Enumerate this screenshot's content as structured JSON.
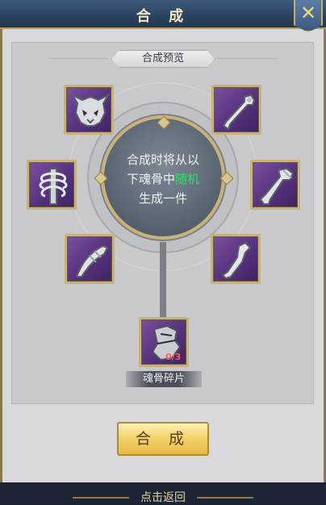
{
  "title": "合 成",
  "close_icon": "close-icon",
  "preview_label": "合成预览",
  "center": {
    "line1": "合成时将从以",
    "line2_pre": "下魂骨中",
    "line2_highlight": "随机",
    "line3": "生成一件"
  },
  "fragment": {
    "count": "0/3",
    "label": "魂骨碎片"
  },
  "craft_button": "合 成",
  "back_text": "点击返回",
  "colors": {
    "title_bar": "#2b4260",
    "highlight": "#32e06b",
    "slot_purple": "#53307a",
    "button_gold": "#f2d36b",
    "count_red": "#ff5a5a"
  },
  "slots": [
    {
      "icon": "skull-helmet-icon"
    },
    {
      "icon": "arm-bone-icon"
    },
    {
      "icon": "rib-cage-icon"
    },
    {
      "icon": "leg-bone-icon"
    },
    {
      "icon": "claw-bone-icon"
    },
    {
      "icon": "bent-bone-icon"
    },
    {
      "icon": "bone-shard-icon"
    }
  ]
}
